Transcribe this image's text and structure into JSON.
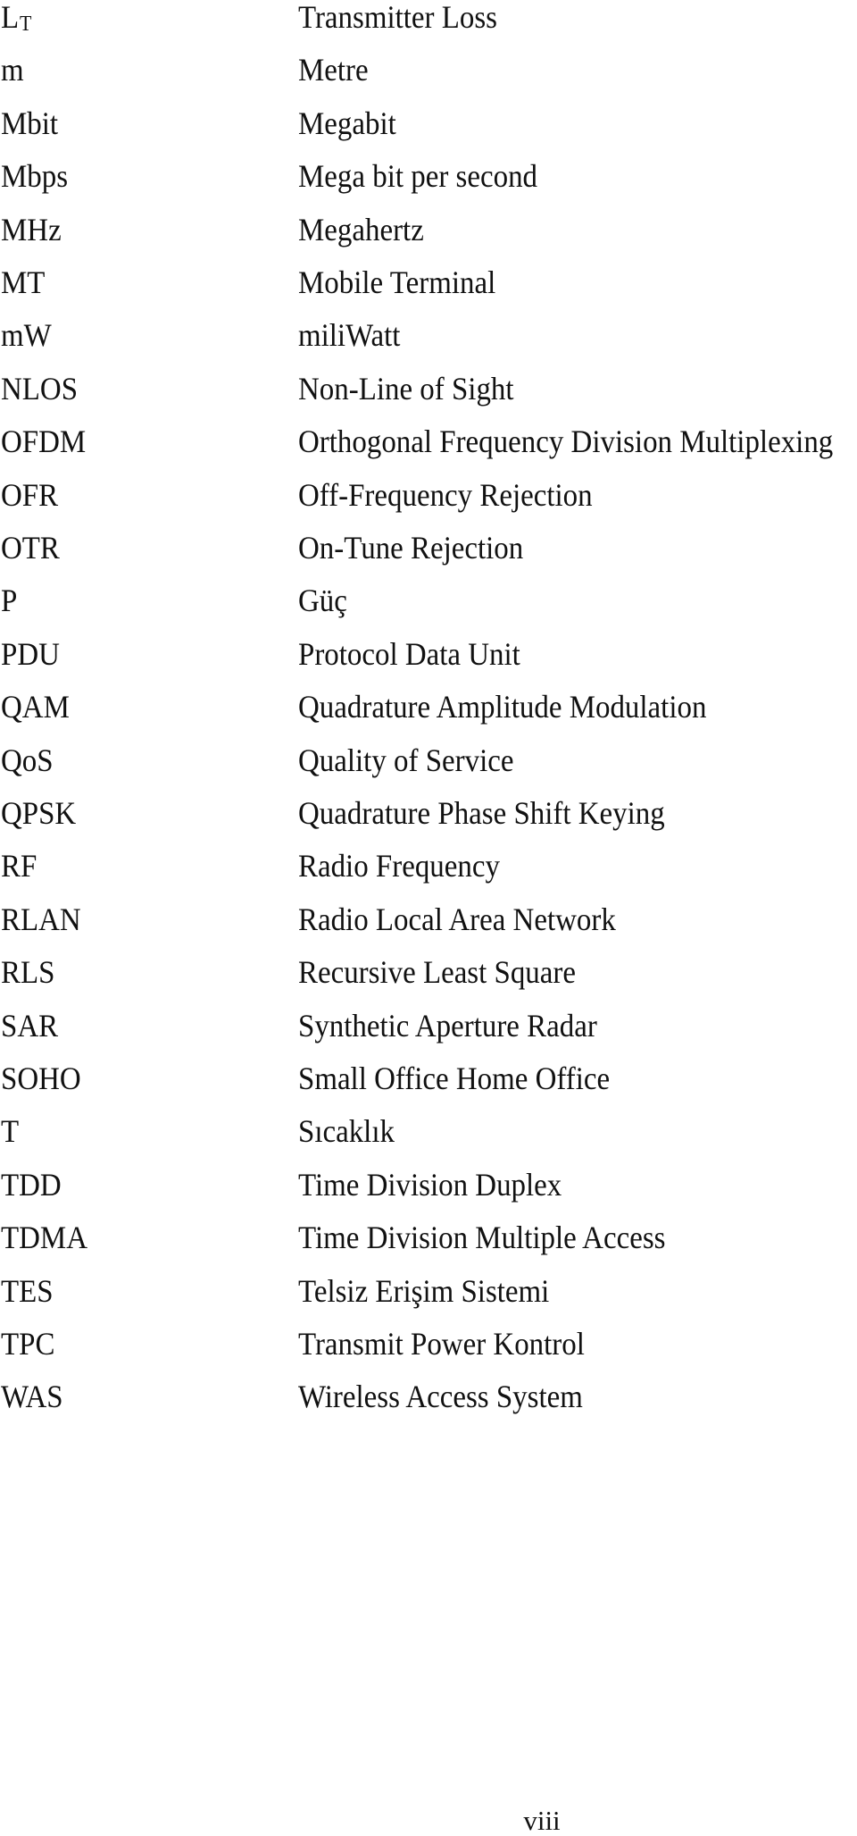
{
  "abbreviations": [
    {
      "term": "L",
      "term_subscript": "T",
      "definition": "Transmitter Loss"
    },
    {
      "term": "m",
      "definition": "Metre"
    },
    {
      "term": "Mbit",
      "definition": "Megabit"
    },
    {
      "term": "Mbps",
      "definition": "Mega bit per second"
    },
    {
      "term": "MHz",
      "definition": "Megahertz"
    },
    {
      "term": "MT",
      "definition": "Mobile Terminal"
    },
    {
      "term": "mW",
      "definition": "miliWatt"
    },
    {
      "term": "NLOS",
      "definition": "Non-Line of Sight"
    },
    {
      "term": "OFDM",
      "definition": "Orthogonal Frequency Division Multiplexing"
    },
    {
      "term": "OFR",
      "definition": "Off-Frequency Rejection"
    },
    {
      "term": "OTR",
      "definition": "On-Tune Rejection"
    },
    {
      "term": "P",
      "definition": "Güç"
    },
    {
      "term": "PDU",
      "definition": "Protocol Data Unit"
    },
    {
      "term": "QAM",
      "definition": "Quadrature Amplitude Modulation"
    },
    {
      "term": "QoS",
      "definition": "Quality of Service"
    },
    {
      "term": "QPSK",
      "definition": "Quadrature Phase Shift Keying"
    },
    {
      "term": "RF",
      "definition": "Radio Frequency"
    },
    {
      "term": "RLAN",
      "definition": "Radio Local Area Network"
    },
    {
      "term": "RLS",
      "definition": "Recursive Least Square"
    },
    {
      "term": "SAR",
      "definition": "Synthetic Aperture Radar"
    },
    {
      "term": "SOHO",
      "definition": "Small Office Home Office"
    },
    {
      "term": "T",
      "definition": "Sıcaklık"
    },
    {
      "term": "TDD",
      "definition": "Time Division Duplex"
    },
    {
      "term": "TDMA",
      "definition": "Time Division Multiple Access"
    },
    {
      "term": "TES",
      "definition": "Telsiz Erişim Sistemi"
    },
    {
      "term": "TPC",
      "definition": "Transmit Power Kontrol"
    },
    {
      "term": "WAS",
      "definition": "Wireless Access System"
    }
  ],
  "page_number": "viii"
}
